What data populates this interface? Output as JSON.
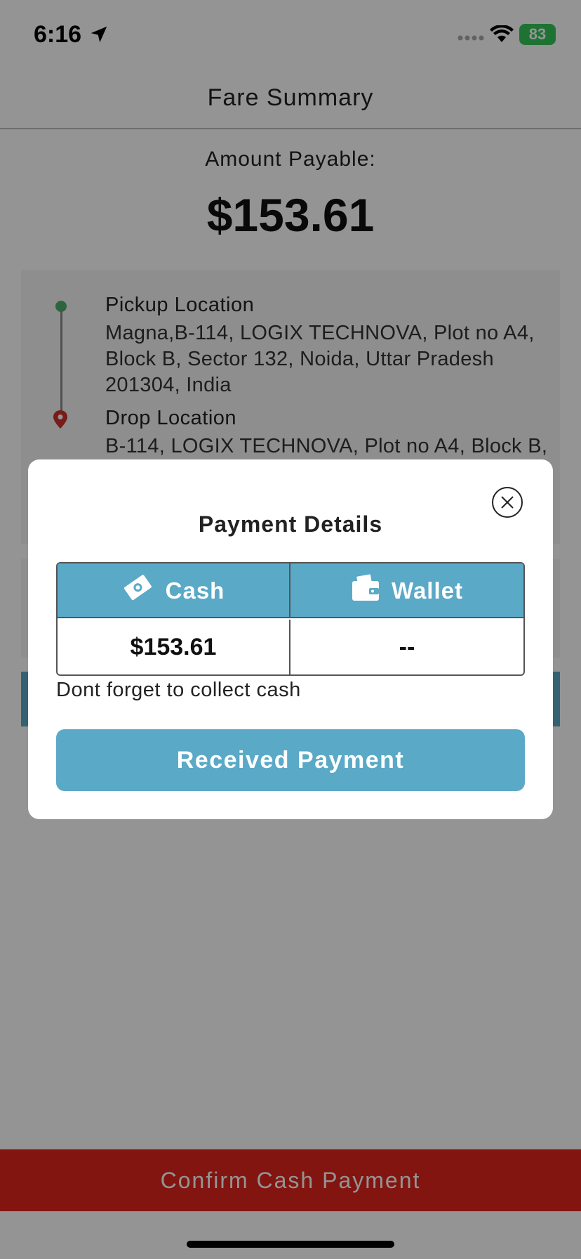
{
  "status_bar": {
    "time": "6:16",
    "battery": "83"
  },
  "nav": {
    "title": "Fare Summary"
  },
  "fare": {
    "amount_label": "Amount Payable:",
    "amount_value": "$153.61"
  },
  "route": {
    "pickup_title": "Pickup Location",
    "pickup_address": "Magna,B-114, LOGIX TECHNOVA, Plot no A4, Block B, Sector 132, Noida, Uttar Pradesh 201304, India",
    "drop_title": "Drop Location",
    "drop_address": "B-114, LOGIX TECHNOVA, Plot no A4, Block B,"
  },
  "modal": {
    "title": "Payment Details",
    "columns": [
      {
        "label": "Cash",
        "icon": "cash-icon",
        "value": "$153.61"
      },
      {
        "label": "Wallet",
        "icon": "wallet-icon",
        "value": "--"
      }
    ],
    "note": "Dont forget to collect cash",
    "button_label": "Received Payment"
  },
  "footer": {
    "confirm_label": "Confirm Cash Payment"
  },
  "colors": {
    "accent": "#5aa9c7",
    "confirm": "#e0251c",
    "pickup": "#4caf6a",
    "drop": "#d0302a"
  }
}
